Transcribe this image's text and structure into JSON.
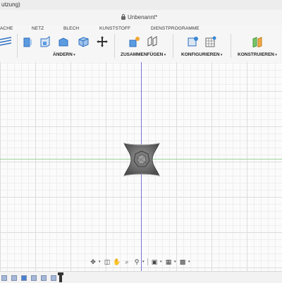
{
  "window": {
    "title_fragment": "utzung)"
  },
  "document": {
    "title": "Unbenannt*"
  },
  "tabs": [
    {
      "label": "ACHE"
    },
    {
      "label": "NETZ"
    },
    {
      "label": "BLECH"
    },
    {
      "label": "KUNSTSTOFF"
    },
    {
      "label": "DIENSTPROGRAMME"
    }
  ],
  "groups": {
    "aendern": "ÄNDERN",
    "zusammenfuegen": "ZUSAMMENFÜGEN",
    "konfigurieren": "KONFIGURIEREN",
    "konstruieren": "KONSTRUIEREN"
  },
  "icons": {
    "toolbar": [
      "sketch-lines-icon",
      "press-pull-icon",
      "fillet-icon",
      "chamfer-icon",
      "shell-icon",
      "move-icon",
      "joint-icon",
      "as-built-joint-icon",
      "configure-icon",
      "parameters-icon",
      "construct-plane-icon"
    ],
    "nav": [
      "orbit-icon",
      "pan-icon",
      "zoom-icon",
      "fit-icon",
      "display-settings-icon",
      "visual-style-icon",
      "viewports-icon"
    ]
  },
  "colors": {
    "axis_vertical": "#7a72d8",
    "axis_horizontal": "#9fd49f",
    "model": "#6b6b6b"
  }
}
